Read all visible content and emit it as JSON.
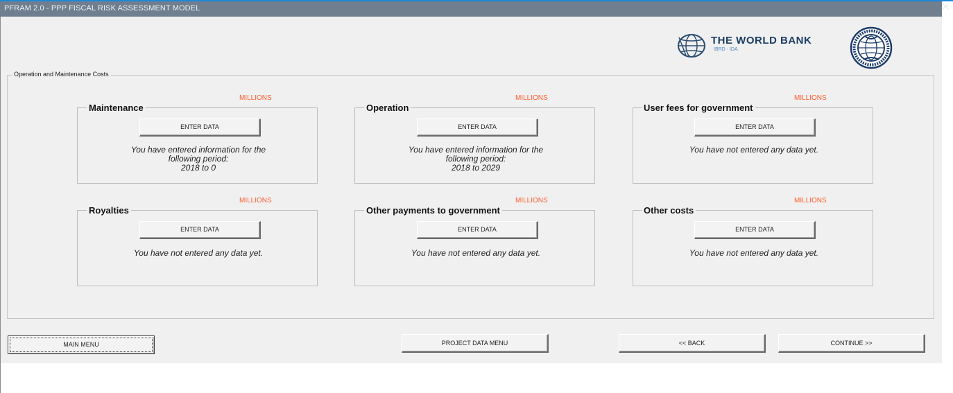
{
  "window": {
    "title": "PFRAM 2.0 - PPP FISCAL RISK ASSESSMENT MODEL",
    "close_glyph": "✕"
  },
  "logos": {
    "world_bank": {
      "name": "THE WORLD BANK",
      "sub": "IBRD · IDA"
    },
    "imf": {
      "name": "INTERNATIONAL MONETARY FUND"
    }
  },
  "group": {
    "label": "Operation and Maintenance Costs"
  },
  "cost_sections": [
    {
      "title": "Maintenance",
      "unit": "MILLIONS",
      "button": "ENTER DATA",
      "status": "You have entered information for the\nfollowing period:\n2018 to 0"
    },
    {
      "title": "Operation",
      "unit": "MILLIONS",
      "button": "ENTER DATA",
      "status": "You have entered information for the\nfollowing period:\n2018 to 2029"
    },
    {
      "title": "User fees for government",
      "unit": "MILLIONS",
      "button": "ENTER DATA",
      "status": "You have not entered any data yet."
    },
    {
      "title": "Royalties",
      "unit": "MILLIONS",
      "button": "ENTER DATA",
      "status": "You have not entered any data yet."
    },
    {
      "title": "Other payments to government",
      "unit": "MILLIONS",
      "button": "ENTER DATA",
      "status": "You have not entered any data yet."
    },
    {
      "title": "Other costs",
      "unit": "MILLIONS",
      "button": "ENTER DATA",
      "status": "You have not entered any data yet."
    }
  ],
  "nav": {
    "main_menu": "MAIN MENU",
    "project_data_menu": "PROJECT DATA MENU",
    "back": "<< BACK",
    "continue": "CONTINUE >>"
  },
  "colors": {
    "title_bar": "#6f7f8f",
    "accent_line": "#1e88d9",
    "millions_label": "#ff5a2a",
    "form_background": "#f0f0f0"
  }
}
